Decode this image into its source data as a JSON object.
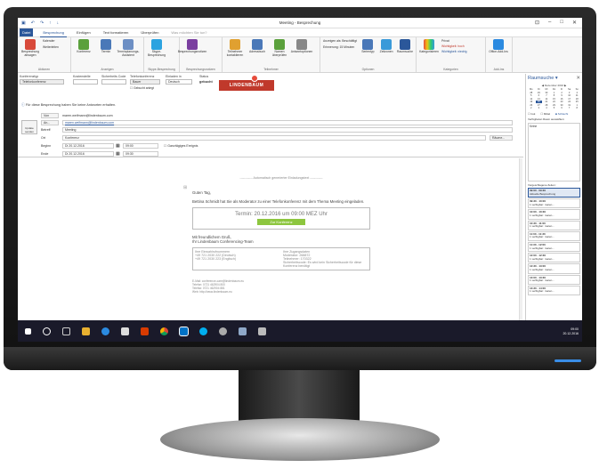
{
  "window": {
    "title": "Meeting - Besprechung",
    "tabs": [
      "Datei",
      "Besprechung",
      "Einfügen",
      "Text formatieren",
      "Überprüfen",
      "Was möchten Sie tun?"
    ]
  },
  "ribbon": {
    "groups": [
      {
        "label": "Aktionen",
        "buttons": [
          "Besprechung absagen",
          "Kalender",
          "Weiterleiten"
        ]
      },
      {
        "label": "Anzeigen",
        "buttons": [
          "Konferenz",
          "Termin",
          "Terminplanungs-Assistent",
          "Status"
        ]
      },
      {
        "label": "Skype-Besprechung",
        "buttons": [
          "Skype-Besprechung"
        ]
      },
      {
        "label": "Besprechungsnotizen",
        "buttons": [
          "Besprechungsnotizen"
        ]
      },
      {
        "label": "Teilnehmer",
        "buttons": [
          "Teilnehmer kontaktieren",
          "Adressbuch",
          "Namen überprüfen",
          "Antwortoptionen"
        ]
      },
      {
        "label": "Optionen",
        "buttons": [
          "Anzeigen als: Beschäftigt",
          "Erinnerung: 15 Minuten",
          "Serientyp",
          "Zeitzonen",
          "Raumsuche"
        ]
      },
      {
        "label": "Kategorien",
        "buttons": [
          "Kategorisieren",
          "Privat",
          "Wichtigkeit: hoch",
          "Wichtigkeit: niedrig"
        ]
      },
      {
        "label": "Add-Ins",
        "buttons": [
          "Office-Add-Ins"
        ]
      }
    ]
  },
  "header_fields": {
    "konferenztyp_label": "Konferenztyp",
    "konferenztyp_value": "Telefonkonferenz",
    "kostenstelle_label": "Kostenstelle",
    "sicherheitscode_label": "Sicherheits Code",
    "telefonkonferenz_label": "Telefonkonferenz",
    "telefonkonferenz_value": "Bauer",
    "einladen_label": "Einladen in",
    "einladen_value": "Deutsch",
    "status_label": "Status",
    "status_value": "gebucht",
    "gebucht_check": "Gebucht anlegt",
    "logo_text": "LINDENBAUM"
  },
  "info_bar": "Für diese Besprechung haben Sie keine Antworten erhalten.",
  "form": {
    "von_label": "Von",
    "von_value": "maren.weifmann@lindenbaum.com",
    "an_label": "An...",
    "an_value": "maren.weifmann@lindenbaum.com",
    "update_label": "Update senden",
    "betreff_label": "Betreff",
    "betreff_value": "Meeting",
    "ort_label": "Ort",
    "ort_value": "Konferenz",
    "raeume_label": "Räume...",
    "beginn_label": "Beginn",
    "beginn_date": "Di 20.12.2016",
    "beginn_time": "09:00",
    "ende_label": "Ende",
    "ende_date": "Di 20.12.2016",
    "ende_time": "09:30",
    "ganztaegig": "Ganztägiges Ereignis"
  },
  "mail": {
    "header": "------------ Automatisch generierter Einladungstext ------------",
    "greeting": "Guten Tag,",
    "intro": "Bettina Schmidt hat Sie als Moderator zu einer Telefonkonferenz mit dem Thema Meeting eingeladen.",
    "termin": "Termin: 20.12.2016 um 09:00 MEZ Uhr",
    "button": "Zur Konferenz",
    "closing1": "Mit freundlichem Gruß,",
    "closing2": "Ihr Lindenbaum Conferencing-Team",
    "dial_title": "Ihre Einwahlrufnummern",
    "dial1": "+49 721 2030 222 (Deutsch)",
    "dial2": "+49 721 2030 223 (Englisch)",
    "access_title": "Ihre Zugangsdaten",
    "access1": "Moderator: 268872",
    "access2": "Teilnehmer: 170322",
    "access3": "Sicherheitscode: Es wird kein Sicherheitscode für diese Konferenz benötigt",
    "footer1": "E-Mail: conference-care@lindenbaum.eu",
    "footer2": "Telefon: 0721 462904 800",
    "footer3": "Telefax: 0721 462904 881",
    "footer4": "Web: http://www.lindenbaum.eu"
  },
  "roomfinder": {
    "title": "Raumsuche",
    "month": "Dezember 2016",
    "weekdays": [
      "Mo",
      "Di",
      "Mi",
      "Do",
      "Fr",
      "Sa",
      "So"
    ],
    "days": [
      "28",
      "29",
      "30",
      "1",
      "2",
      "3",
      "4",
      "5",
      "6",
      "7",
      "8",
      "9",
      "10",
      "11",
      "12",
      "13",
      "14",
      "15",
      "16",
      "17",
      "18",
      "19",
      "20",
      "21",
      "22",
      "23",
      "24",
      "25",
      "26",
      "27",
      "28",
      "29",
      "30",
      "31",
      "1",
      "2",
      "3",
      "4",
      "5",
      "6",
      "7",
      "8"
    ],
    "selected_day_index": 22,
    "legend": [
      "Gut",
      "Mittel",
      "Schlecht"
    ],
    "rooms_label": "Verfügbaren Raum auswählen:",
    "rooms_value": "Keine",
    "suggested_label": "Vorgeschlagene Zeiten:",
    "slots": [
      {
        "time": "09:00 - 09:30",
        "text": "Aktuelle Besprechung"
      },
      {
        "time": "09:30 - 10:00",
        "text": "1 verfügbar: maren..."
      },
      {
        "time": "10:00 - 10:30",
        "text": "1 verfügbar: maren..."
      },
      {
        "time": "10:30 - 11:00",
        "text": "1 verfügbar: maren..."
      },
      {
        "time": "11:00 - 11:30",
        "text": "1 verfügbar: maren..."
      },
      {
        "time": "11:30 - 12:00",
        "text": "1 verfügbar: maren..."
      },
      {
        "time": "12:00 - 12:30",
        "text": "1 verfügbar: maren..."
      },
      {
        "time": "12:30 - 13:00",
        "text": "1 verfügbar: maren..."
      },
      {
        "time": "13:00 - 13:30",
        "text": "1 verfügbar: maren..."
      },
      {
        "time": "13:30 - 14:00",
        "text": "1 verfügbar: maren..."
      }
    ]
  },
  "taskbar": {
    "time": "09:00",
    "date": "20.12.2016",
    "icons": [
      "windows-icon",
      "search-icon",
      "task-view-icon",
      "file-explorer-icon",
      "edge-icon",
      "store-icon",
      "office-icon",
      "chrome-icon",
      "outlook-icon",
      "skype-icon",
      "settings-icon",
      "mail-icon",
      "pen-icon"
    ]
  }
}
